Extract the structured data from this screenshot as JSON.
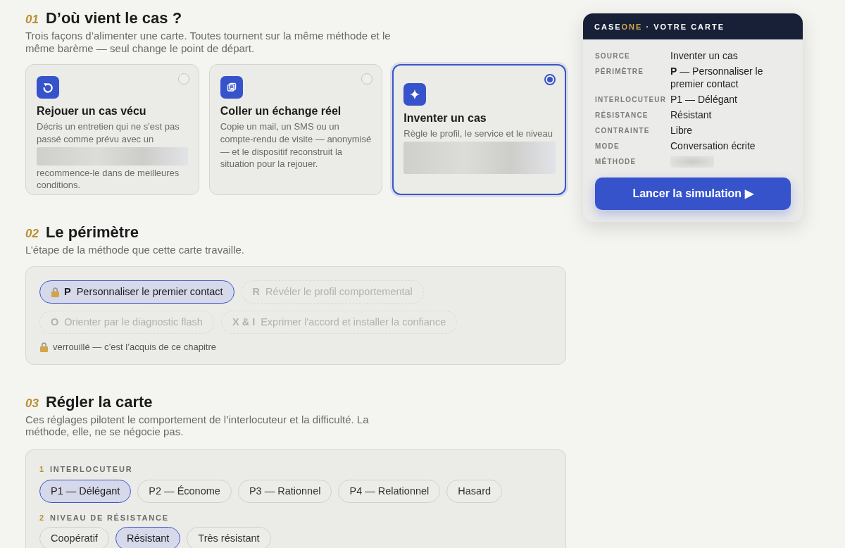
{
  "source_section": {
    "number": "01",
    "title": "D’où vient le cas ?",
    "description": "Trois façons d’alimenter une carte. Toutes tournent sur la même méthode et le même barème — seul change le point de départ.",
    "cards": [
      {
        "title": "Rejouer un cas vécu",
        "selected": false,
        "description_parts": [
          {
            "kind": "text",
            "text": "Décris un entretien qui ne s'est pas passé comme prévu avec un"
          },
          {
            "kind": "redacted"
          },
          {
            "kind": "text",
            "text": "recommence-le dans de meilleures conditions."
          }
        ]
      },
      {
        "title": "Coller un échange réel",
        "selected": false,
        "description_parts": [
          {
            "kind": "text",
            "text": "Copie un mail, un SMS ou un compte-rendu de visite — anonymisé — et le dispositif reconstruit la situation pour la rejouer."
          }
        ]
      },
      {
        "title": "Inventer un cas",
        "selected": true,
        "description_parts": [
          {
            "kind": "text",
            "text": "Règle le profil, le service et le niveau"
          },
          {
            "kind": "redacted"
          }
        ]
      }
    ]
  },
  "perimeter_section": {
    "number": "02",
    "title": "Le périmètre",
    "description": "L’étape de la méthode que cette carte travaille.",
    "steps": [
      {
        "letter": "P",
        "label": "Personnaliser le premier contact",
        "selected": true,
        "locked": true,
        "disabled": false
      },
      {
        "letter": "R",
        "label": "Révéler le profil comportemental",
        "selected": false,
        "locked": false,
        "disabled": true
      },
      {
        "letter": "O",
        "label": "Orienter par le diagnostic flash",
        "selected": false,
        "locked": false,
        "disabled": true
      },
      {
        "letter": "X & I",
        "label": "Exprimer l'accord et installer la confiance",
        "selected": false,
        "locked": false,
        "disabled": true
      }
    ],
    "legend": "verrouillé — c’est l’acquis de ce chapitre"
  },
  "settings_section": {
    "number": "03",
    "title": "Régler la carte",
    "description": "Ces réglages pilotent le comportement de l’interlocuteur et la difficulté. La méthode, elle, ne se négocie pas.",
    "groups": [
      {
        "number": "1",
        "label": "INTERLOCUTEUR",
        "options": [
          {
            "label": "P1 — Délégant",
            "selected": true
          },
          {
            "label": "P2 — Économe",
            "selected": false
          },
          {
            "label": "P3 — Rationnel",
            "selected": false
          },
          {
            "label": "P4 — Relationnel",
            "selected": false
          },
          {
            "label": "Hasard",
            "selected": false
          }
        ]
      },
      {
        "number": "2",
        "label": "NIVEAU DE RÉSISTANCE",
        "options": [
          {
            "label": "Coopératif",
            "selected": false
          },
          {
            "label": "Résistant",
            "selected": true
          },
          {
            "label": "Très résistant",
            "selected": false
          }
        ]
      }
    ]
  },
  "summary_card": {
    "title_parts": [
      {
        "text": "CASE",
        "accent": false
      },
      {
        "text": "ONE",
        "accent": true
      },
      {
        "text": " · VOTRE CARTE",
        "accent": false
      }
    ],
    "rows": [
      {
        "label": "SOURCE",
        "kind": "text",
        "value": "Inventer un cas"
      },
      {
        "label": "PÉRIMÈTRE",
        "kind": "text",
        "value": "**P** — Personnaliser le premier contact"
      },
      {
        "label": "INTERLOCUTEUR",
        "kind": "text",
        "value": "P1 — Délégant"
      },
      {
        "label": "RÉSISTANCE",
        "kind": "text",
        "value": "Résistant"
      },
      {
        "label": "CONTRAINTE",
        "kind": "text",
        "value": "Libre"
      },
      {
        "label": "MODE",
        "kind": "text",
        "value": "Conversation écrite"
      },
      {
        "label": "MÉTHODE",
        "kind": "redacted"
      }
    ],
    "button": "Lancer la simulation ▶"
  }
}
